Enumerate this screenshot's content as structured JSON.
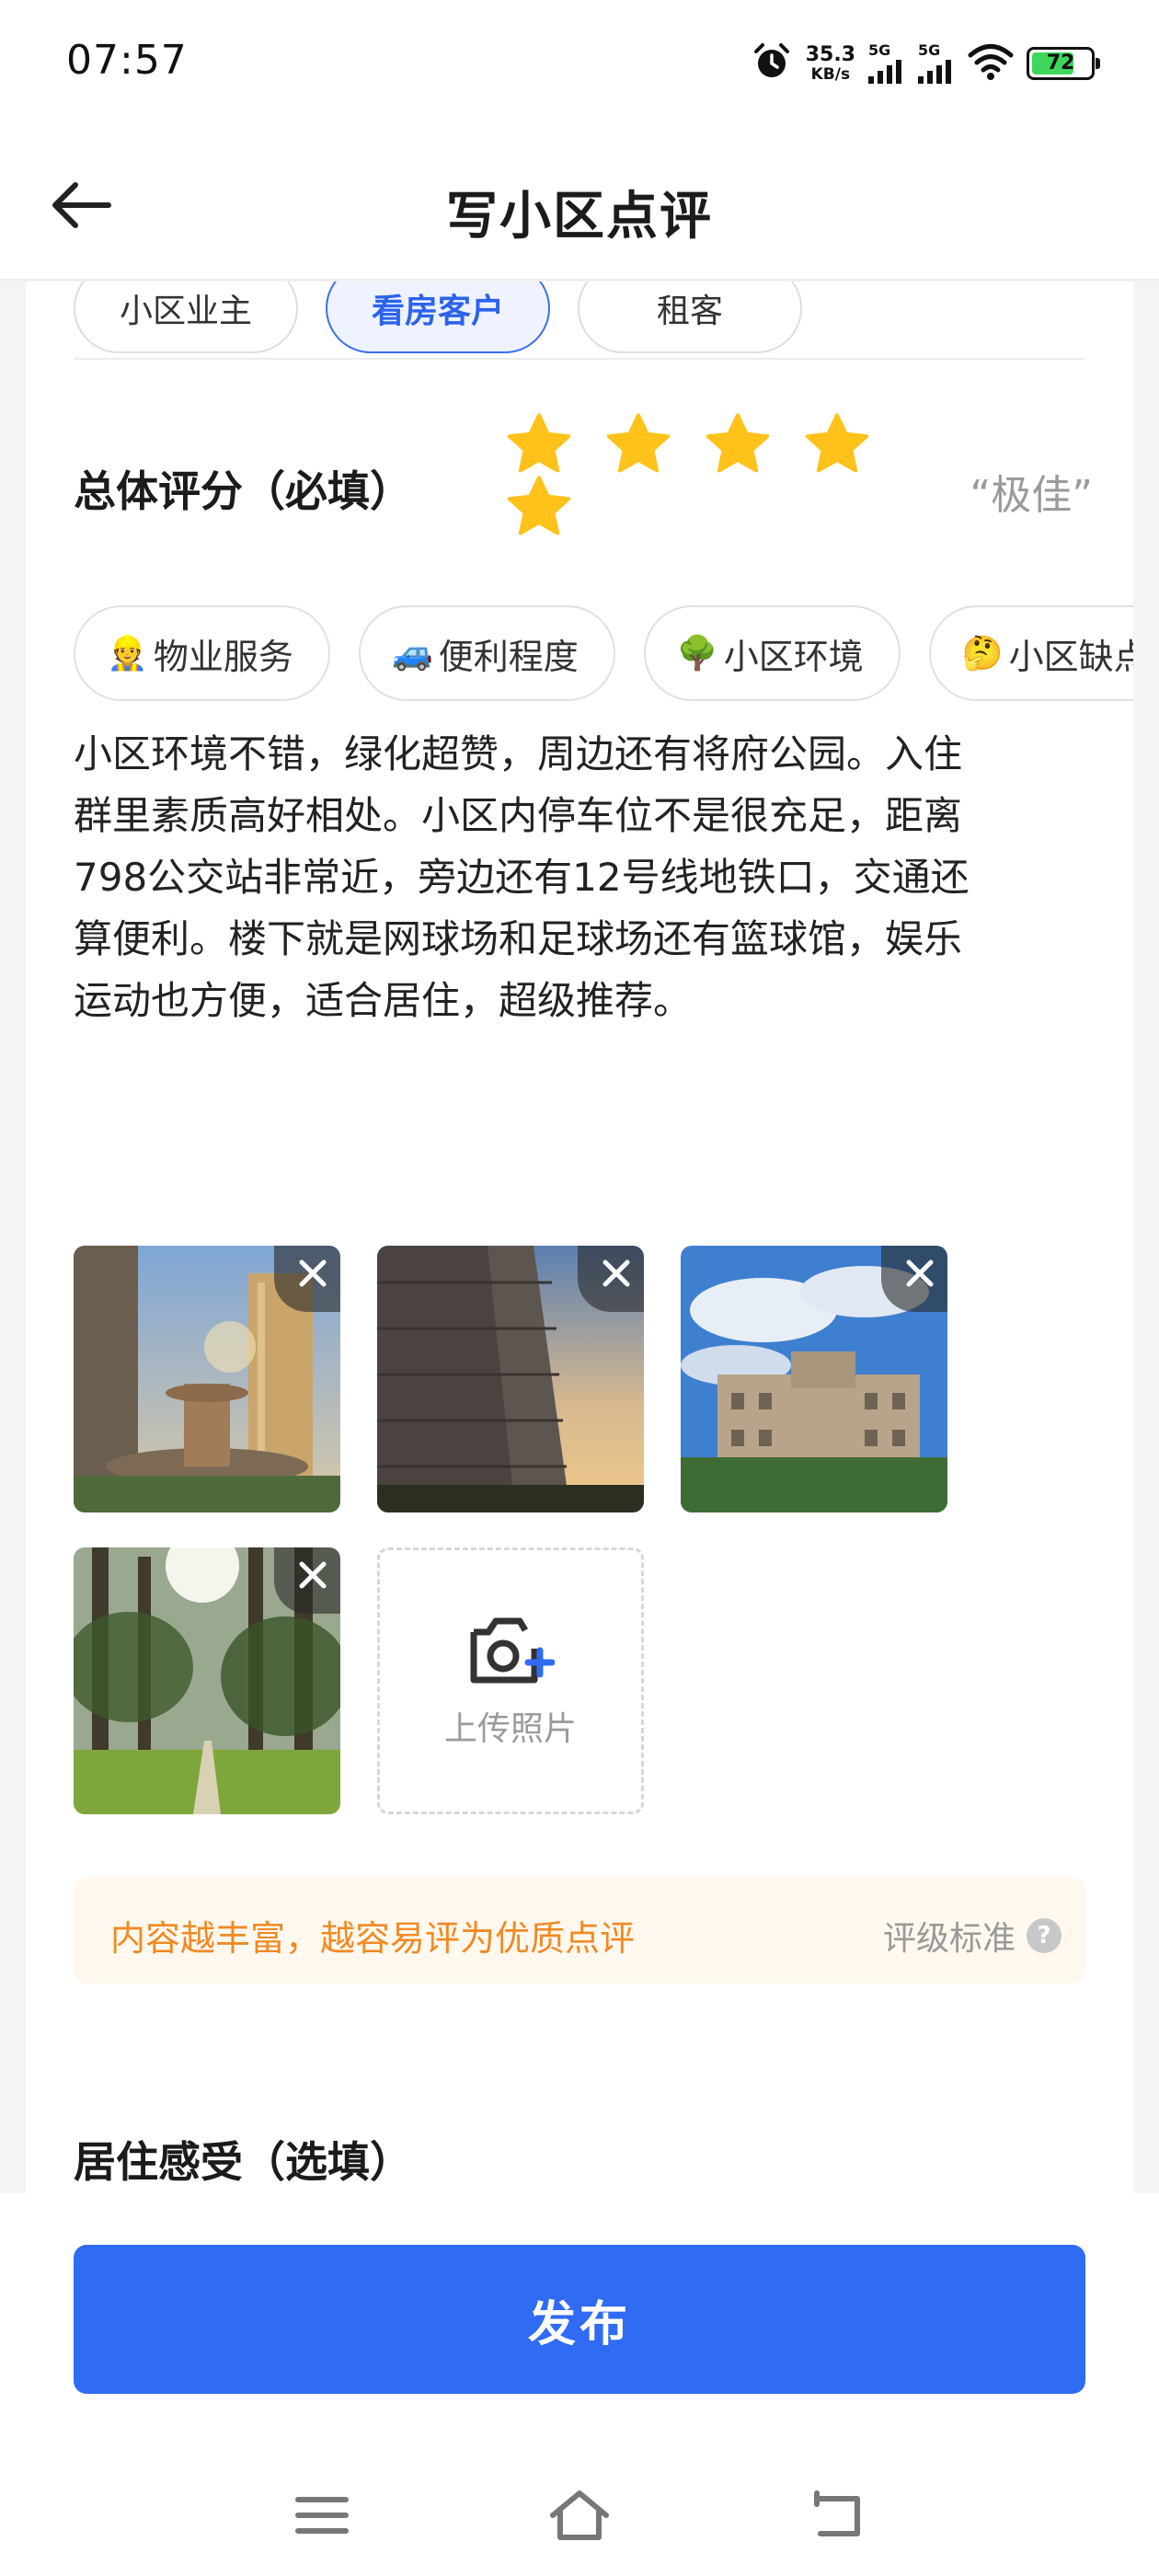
{
  "status_bar": {
    "time": "07:57",
    "net_speed": "35.3",
    "net_unit": "KB/s",
    "sim1": "5G",
    "sim2": "5G",
    "battery": "72",
    "battery_level": 0.72
  },
  "header": {
    "title": "写小区点评",
    "back_icon": "back-arrow-icon"
  },
  "roles": [
    {
      "label": "小区业主",
      "active": false
    },
    {
      "label": "看房客户",
      "active": true
    },
    {
      "label": "租客",
      "active": false
    }
  ],
  "rating": {
    "label": "总体评分（必填）",
    "stars": 5,
    "max_stars": 5,
    "word": "“极佳”",
    "star_color": "#FFC21A"
  },
  "tags": [
    {
      "emoji": "👷",
      "label": "物业服务"
    },
    {
      "emoji": "🚙",
      "label": "便利程度"
    },
    {
      "emoji": "🌳",
      "label": "小区环境"
    },
    {
      "emoji": "🤔",
      "label": "小区缺点"
    }
  ],
  "review_text": "小区环境不错，绿化超赞，周边还有将府公园。入住\n群里素质高好相处。小区内停车位不是很充足，距离\n798公交站非常近，旁边还有12号线地铁口，交通还\n算便利。楼下就是网球场和足球场还有篮球馆，娱乐\n运动也方便，适合居住，超级推荐。",
  "photos": {
    "count": 4,
    "delete_icon": "close-icon",
    "upload_label": "上传照片",
    "upload_icon": "camera-plus-icon"
  },
  "tip": {
    "text": "内容越丰富，越容易评为优质点评",
    "standard_label": "评级标准",
    "help_icon": "question-icon"
  },
  "section2": {
    "title": "居住感受（选填）"
  },
  "publish": {
    "label": "发布",
    "color": "#2F6BF3"
  },
  "system_nav": {
    "menu_icon": "menu-icon",
    "home_icon": "home-icon",
    "back_icon": "return-icon"
  }
}
